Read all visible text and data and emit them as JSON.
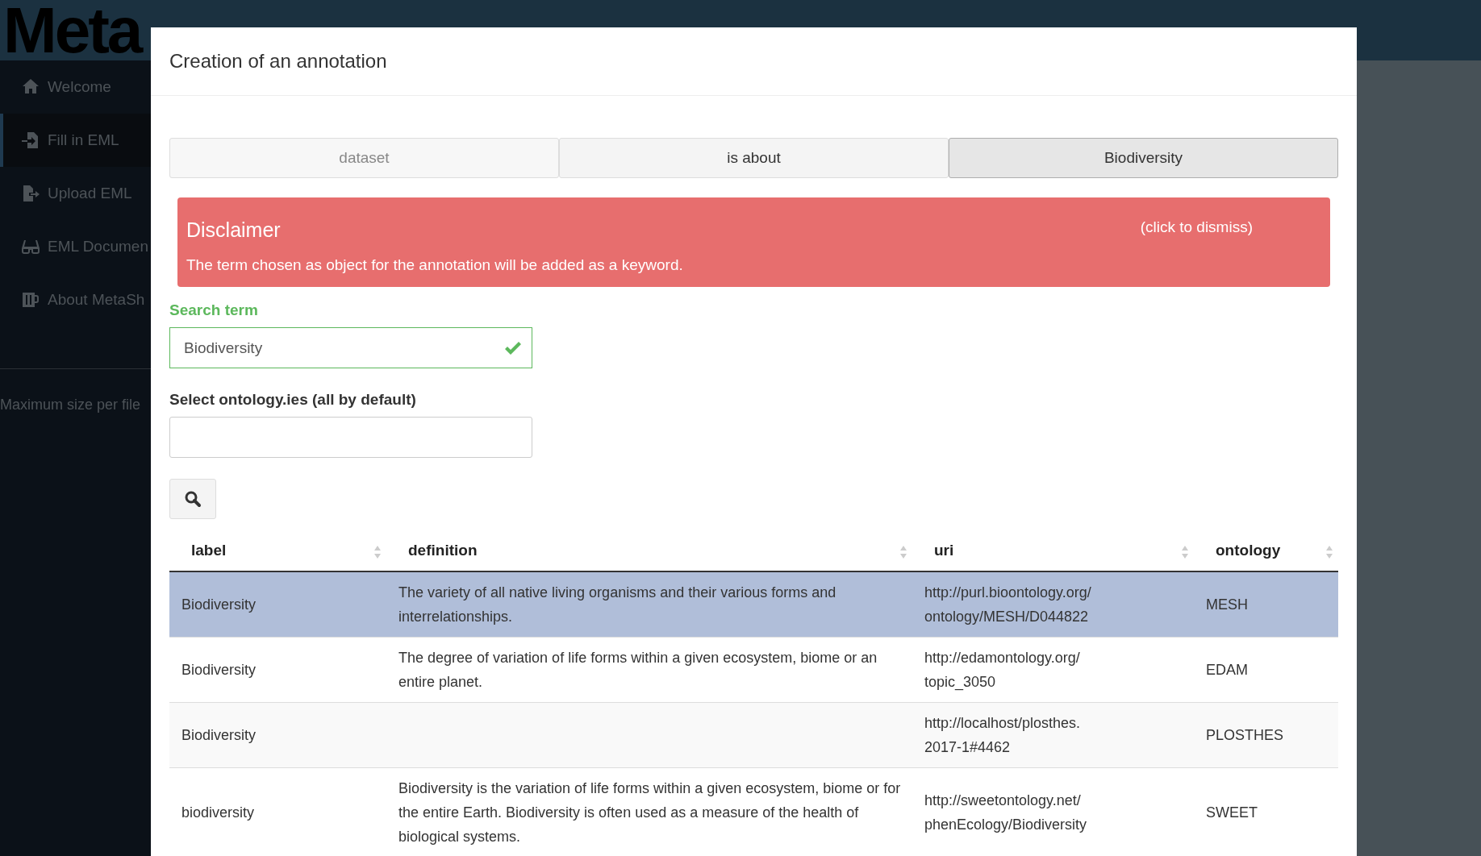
{
  "logo": {
    "text": "Meta"
  },
  "sidebar": {
    "items": [
      {
        "label": "Welcome",
        "selected": false
      },
      {
        "label": "Fill in EML",
        "selected": true
      },
      {
        "label": "Upload EML",
        "selected": false
      },
      {
        "label": "EML Documen",
        "selected": false
      },
      {
        "label": "About MetaSh",
        "selected": false
      }
    ],
    "footer": "Maximum size per file"
  },
  "modal": {
    "title": "Creation of an annotation",
    "tabs": [
      {
        "label": "dataset",
        "selected": false,
        "disabled": true
      },
      {
        "label": "is about",
        "selected": false,
        "disabled": false
      },
      {
        "label": "Biodiversity",
        "selected": true,
        "disabled": false
      }
    ],
    "alert": {
      "title": "Disclaimer",
      "dismiss": "(click to dismiss)",
      "text": "The term chosen as object for the annotation will be added as a keyword."
    },
    "search_field": {
      "label": "Search term",
      "value": "Biodiversity",
      "valid": true
    },
    "ontology_field": {
      "label": "Select ontology.ies (all by default)"
    },
    "table": {
      "columns": [
        "label",
        "definition",
        "uri",
        "ontology"
      ],
      "rows": [
        {
          "selected": true,
          "cells": [
            "Biodiversity",
            "The variety of all native living organisms and their various forms and interrelationships.",
            "http://purl.bioontology.org/\nontology/MESH/D044822",
            "MESH"
          ]
        },
        {
          "selected": false,
          "cells": [
            "Biodiversity",
            "The degree of variation of life forms within a given ecosystem, biome or an entire planet.",
            "http://edamontology.org/\ntopic_3050",
            "EDAM"
          ]
        },
        {
          "selected": false,
          "cells": [
            "Biodiversity",
            "",
            "http://localhost/plosthes.\n2017-1#4462",
            "PLOSTHES"
          ]
        },
        {
          "selected": false,
          "cells": [
            "biodiversity",
            "Biodiversity is the variation of life forms within a given ecosystem, biome or for the entire Earth. Biodiversity is often used as a measure of the health of biological systems.",
            "http://sweetontology.net/\nphenEcology/Biodiversity",
            "SWEET"
          ]
        }
      ]
    }
  }
}
